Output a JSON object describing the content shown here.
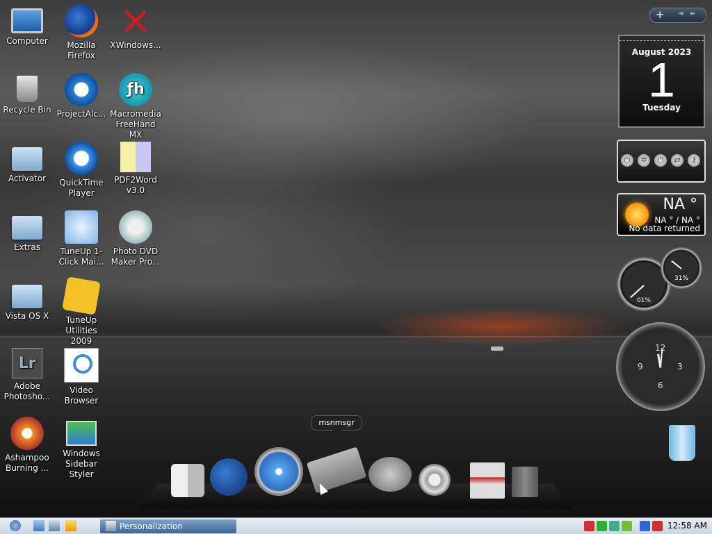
{
  "desktop_icons": [
    {
      "label": "Computer",
      "icon": "monitor-icon"
    },
    {
      "label": "Mozilla Firefox",
      "icon": "firefox-icon"
    },
    {
      "label": "XWindows...",
      "icon": "xwindows-icon"
    },
    {
      "label": "Recycle Bin",
      "icon": "recycle-bin-icon"
    },
    {
      "label": "ProjectAlc...",
      "icon": "internet-explorer-icon"
    },
    {
      "label": "Macromedia FreeHand MX",
      "icon": "freehand-icon"
    },
    {
      "label": "Activator",
      "icon": "folder-icon"
    },
    {
      "label": "QuickTime Player",
      "icon": "quicktime-icon"
    },
    {
      "label": "PDF2Word v3.0",
      "icon": "pdf2word-icon"
    },
    {
      "label": "Extras",
      "icon": "folder-icon"
    },
    {
      "label": "TuneUp 1-Click Mai...",
      "icon": "tuneup-maintenance-icon"
    },
    {
      "label": "Photo DVD Maker Pro...",
      "icon": "photo-dvd-icon"
    },
    {
      "label": "Vista OS X",
      "icon": "folder-icon"
    },
    {
      "label": "TuneUp Utilities 2009",
      "icon": "tuneup-utilities-icon"
    },
    {
      "label": "Adobe Photosho...",
      "icon": "lightroom-icon"
    },
    {
      "label": "Video Browser",
      "icon": "video-browser-icon"
    },
    {
      "label": "Ashampoo Burning ...",
      "icon": "ashampoo-icon"
    },
    {
      "label": "Windows Sidebar Styler",
      "icon": "sidebar-styler-icon"
    }
  ],
  "sidebar_bar": {
    "add": "+",
    "prev": "◄",
    "next": "►"
  },
  "calendar": {
    "month": "August 2023",
    "day": "1",
    "weekday": "Tuesday"
  },
  "controls": {
    "buttons": [
      "power-icon",
      "settings-icon",
      "shutdown-icon",
      "switch-icon",
      "key-icon"
    ]
  },
  "weather": {
    "temp": "NA °",
    "range": "NA ° / NA °",
    "message": "No data returned",
    "icon": "sun-icon"
  },
  "meters": {
    "cpu": "01%",
    "memory": "31%",
    "cpu_level": 0.01,
    "memory_level": 0.31
  },
  "clock": {
    "n12": "12",
    "n3": "3",
    "n6": "6",
    "n9": "9"
  },
  "dock": {
    "tooltip": "msnmsgr",
    "items": [
      "finder-icon",
      "browser-globe-icon",
      "safari-icon",
      "messenger-icon",
      "video-chat-icon",
      "settings-gear-icon",
      "mail-icon",
      "trash-icon"
    ]
  },
  "taskbar": {
    "quick_launch": [
      "start-orb-icon",
      "explorer-icon",
      "desktop-icon",
      "media-icon"
    ],
    "task": "Personalization",
    "tray_icons": [
      "tray-icon-1",
      "tray-icon-2",
      "tray-icon-3",
      "tray-icon-4",
      "tray-icon-5",
      "tray-icon-6"
    ],
    "time": "12:58 AM"
  }
}
